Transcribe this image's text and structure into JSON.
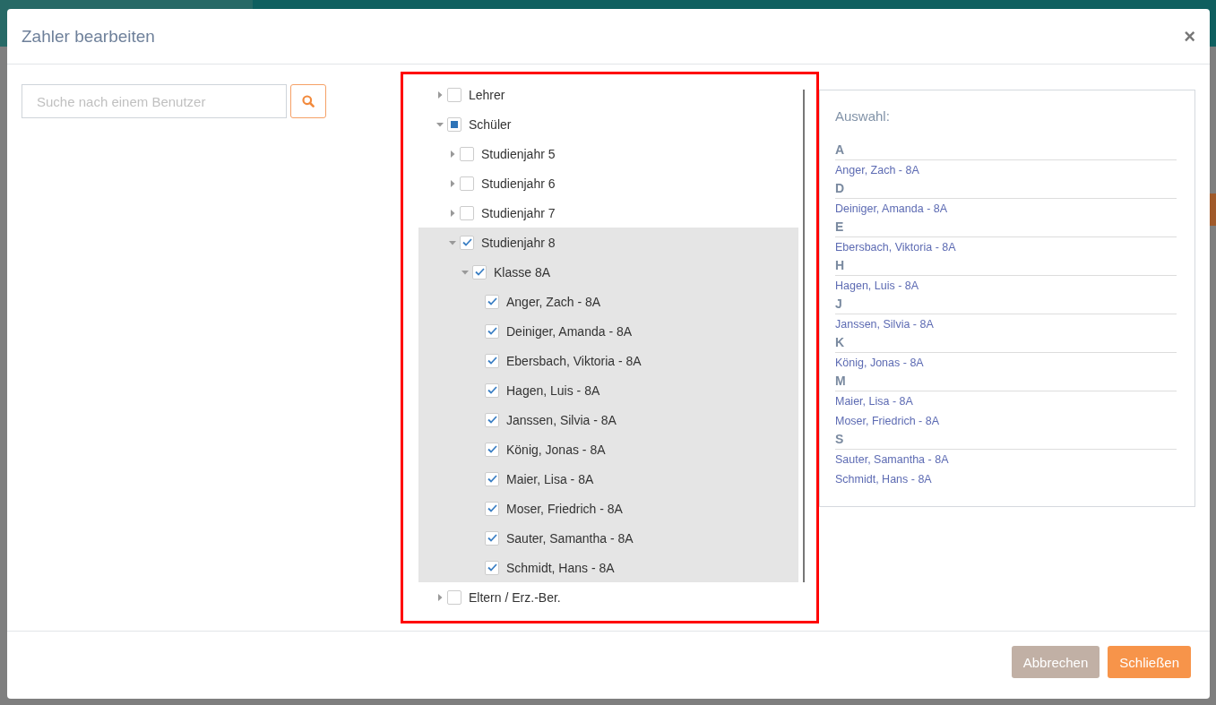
{
  "dialog": {
    "title": "Zahler bearbeiten",
    "close": "×"
  },
  "search": {
    "placeholder": "Suche nach einem Benutzer"
  },
  "tree": {
    "nodes": [
      {
        "label": "Lehrer",
        "expanded": false,
        "checked": false,
        "partial": false,
        "highlighted": false
      },
      {
        "label": "Schüler",
        "expanded": true,
        "partial": true,
        "highlighted": false,
        "children": [
          {
            "label": "Studienjahr 5",
            "expanded": false,
            "checked": false,
            "partial": false,
            "highlighted": false
          },
          {
            "label": "Studienjahr 6",
            "expanded": false,
            "checked": false,
            "partial": false,
            "highlighted": false
          },
          {
            "label": "Studienjahr 7",
            "expanded": false,
            "checked": false,
            "partial": false,
            "highlighted": false
          },
          {
            "label": "Studienjahr 8",
            "expanded": true,
            "checked": true,
            "highlighted": true,
            "children": [
              {
                "label": "Klasse 8A",
                "expanded": true,
                "checked": true,
                "highlighted": false,
                "children": [
                  {
                    "label": "Anger, Zach - 8A",
                    "checked": true
                  },
                  {
                    "label": "Deiniger, Amanda - 8A",
                    "checked": true
                  },
                  {
                    "label": "Ebersbach, Viktoria - 8A",
                    "checked": true
                  },
                  {
                    "label": "Hagen, Luis - 8A",
                    "checked": true
                  },
                  {
                    "label": "Janssen, Silvia - 8A",
                    "checked": true
                  },
                  {
                    "label": "König, Jonas - 8A",
                    "checked": true
                  },
                  {
                    "label": "Maier, Lisa - 8A",
                    "checked": true
                  },
                  {
                    "label": "Moser, Friedrich - 8A",
                    "checked": true
                  },
                  {
                    "label": "Sauter, Samantha - 8A",
                    "checked": true
                  },
                  {
                    "label": "Schmidt, Hans - 8A",
                    "checked": true
                  }
                ]
              }
            ]
          }
        ]
      },
      {
        "label": "Eltern / Erz.-Ber.",
        "expanded": false,
        "checked": false,
        "partial": false,
        "highlighted": false
      }
    ]
  },
  "selection": {
    "title": "Auswahl:",
    "groups": [
      {
        "letter": "A",
        "items": [
          "Anger, Zach - 8A"
        ]
      },
      {
        "letter": "D",
        "items": [
          "Deiniger, Amanda - 8A"
        ]
      },
      {
        "letter": "E",
        "items": [
          "Ebersbach, Viktoria - 8A"
        ]
      },
      {
        "letter": "H",
        "items": [
          "Hagen, Luis - 8A"
        ]
      },
      {
        "letter": "J",
        "items": [
          "Janssen, Silvia - 8A"
        ]
      },
      {
        "letter": "K",
        "items": [
          "König, Jonas - 8A"
        ]
      },
      {
        "letter": "M",
        "items": [
          "Maier, Lisa - 8A",
          "Moser, Friedrich - 8A"
        ]
      },
      {
        "letter": "S",
        "items": [
          "Sauter, Samantha - 8A",
          "Schmidt, Hans - 8A"
        ]
      }
    ]
  },
  "buttons": [
    {
      "label": "Abbrechen",
      "kind": "secondary"
    },
    {
      "label": "Schließen",
      "kind": "primary"
    }
  ]
}
